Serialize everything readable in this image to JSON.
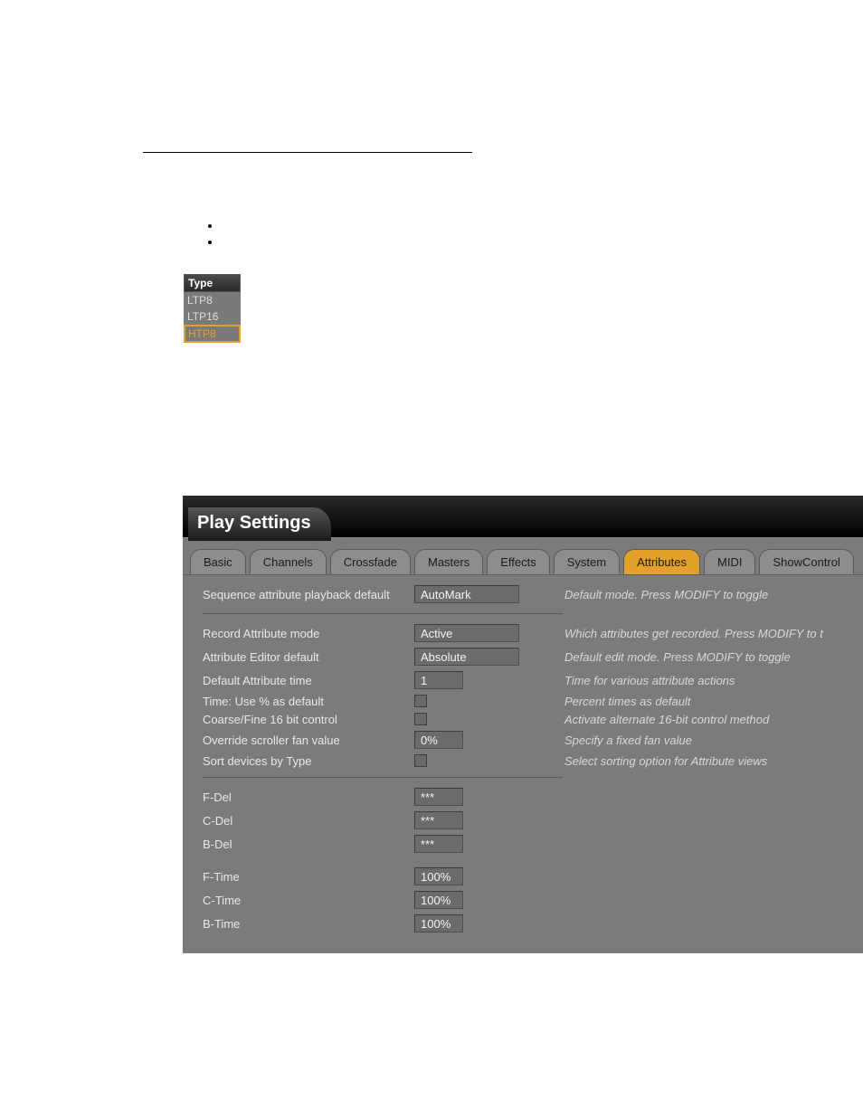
{
  "type_menu": {
    "header": "Type",
    "items": [
      "LTP8",
      "LTP16",
      "HTP8"
    ],
    "selected_index": 2
  },
  "panel": {
    "title": "Play Settings",
    "tabs": [
      "Basic",
      "Channels",
      "Crossfade",
      "Masters",
      "Effects",
      "System",
      "Attributes",
      "MIDI",
      "ShowControl"
    ],
    "active_tab_index": 6,
    "rows": {
      "seq_attr_playback": {
        "label": "Sequence attribute playback default",
        "value": "AutoMark",
        "desc": "Default mode. Press MODIFY to toggle"
      },
      "record_attr_mode": {
        "label": "Record Attribute mode",
        "value": "Active",
        "desc": "Which attributes get recorded. Press MODIFY to t"
      },
      "attr_editor_default": {
        "label": "Attribute Editor default",
        "value": "Absolute",
        "desc": "Default edit mode. Press MODIFY to toggle"
      },
      "default_attr_time": {
        "label": "Default Attribute time",
        "value": "1",
        "desc": "Time for various attribute actions"
      },
      "time_pct_default": {
        "label": "Time: Use % as default",
        "desc": "Percent times as default"
      },
      "coarse_fine_16": {
        "label": "Coarse/Fine 16 bit control",
        "desc": "Activate alternate 16-bit control method"
      },
      "override_scroller_fan": {
        "label": "Override scroller fan value",
        "value": "0%",
        "desc": "Specify a fixed fan value"
      },
      "sort_devices": {
        "label": "Sort devices by Type",
        "desc": "Select sorting option for Attribute views"
      },
      "f_del": {
        "label": "F-Del",
        "value": "***"
      },
      "c_del": {
        "label": "C-Del",
        "value": "***"
      },
      "b_del": {
        "label": "B-Del",
        "value": "***"
      },
      "f_time": {
        "label": "F-Time",
        "value": "100%"
      },
      "c_time": {
        "label": "C-Time",
        "value": "100%"
      },
      "b_time": {
        "label": "B-Time",
        "value": "100%"
      }
    }
  }
}
